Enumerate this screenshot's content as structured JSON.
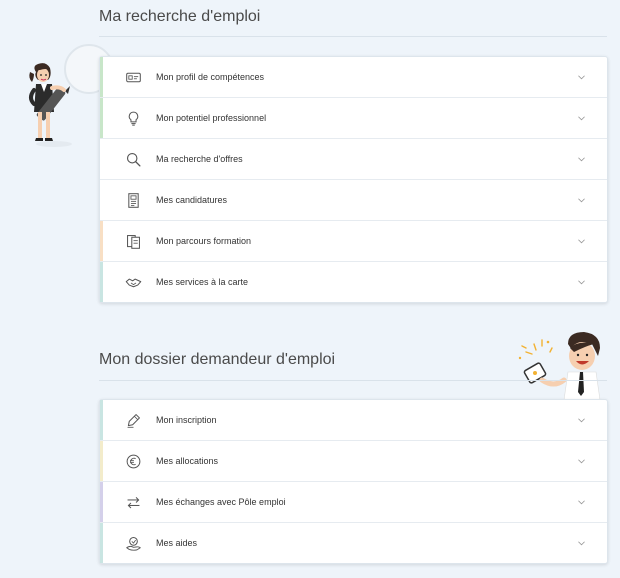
{
  "colors": {
    "background": "#eef4fa",
    "accent_green": "#c8e6c9",
    "accent_yellow": "#f3eccb",
    "accent_orange": "#f8dfc4",
    "accent_purple": "#d4d0ea",
    "accent_teal": "#c9e5e2"
  },
  "recherche": {
    "title": "Ma recherche d'emploi",
    "items": [
      {
        "label": "Mon profil de compétences",
        "icon": "id-card-icon",
        "accent": "#c8e6c9"
      },
      {
        "label": "Mon potentiel professionnel",
        "icon": "lightbulb-icon",
        "accent": "#c8e6c9"
      },
      {
        "label": "Ma recherche d'offres",
        "icon": "search-icon",
        "accent": "#ffffff"
      },
      {
        "label": "Mes candidatures",
        "icon": "document-icon",
        "accent": "#ffffff"
      },
      {
        "label": "Mon parcours formation",
        "icon": "book-icon",
        "accent": "#f8dfc4"
      },
      {
        "label": "Mes services à la carte",
        "icon": "handshake-icon",
        "accent": "#c9e5e2"
      }
    ]
  },
  "dossier": {
    "title": "Mon dossier demandeur d'emploi",
    "items": [
      {
        "label": "Mon inscription",
        "icon": "pen-icon",
        "accent": "#c9e5e2"
      },
      {
        "label": "Mes allocations",
        "icon": "euro-icon",
        "accent": "#f3eccb"
      },
      {
        "label": "Mes échanges avec Pôle emploi",
        "icon": "exchange-icon",
        "accent": "#d4d0ea"
      },
      {
        "label": "Mes aides",
        "icon": "aid-icon",
        "accent": "#c9e5e2"
      }
    ]
  }
}
